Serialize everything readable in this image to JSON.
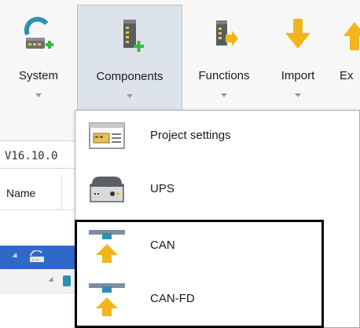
{
  "ribbon": {
    "buttons": [
      {
        "label": "System",
        "icon": "system-add-icon"
      },
      {
        "label": "Components",
        "icon": "components-add-icon"
      },
      {
        "label": "Functions",
        "icon": "functions-icon"
      },
      {
        "label": "Import",
        "icon": "import-arrow-icon"
      },
      {
        "label": "Ex",
        "icon": "export-arrow-icon"
      }
    ]
  },
  "panel": {
    "version": "V16.10.0",
    "name_header": "Name"
  },
  "menu": {
    "items": [
      {
        "label": "Project settings",
        "icon": "project-settings-icon"
      },
      {
        "label": "UPS",
        "icon": "ups-device-icon"
      },
      {
        "label": "CAN",
        "icon": "can-bus-icon"
      },
      {
        "label": "CAN-FD",
        "icon": "can-fd-bus-icon"
      }
    ]
  },
  "colors": {
    "ribbon_bg": "#f7f7f7",
    "active_button_bg": "#dde3ea",
    "selection_blue": "#2f68c8",
    "green_plus": "#3cb44a",
    "arrow_yellow": "#f2b51b",
    "highlight_border": "#000000"
  }
}
